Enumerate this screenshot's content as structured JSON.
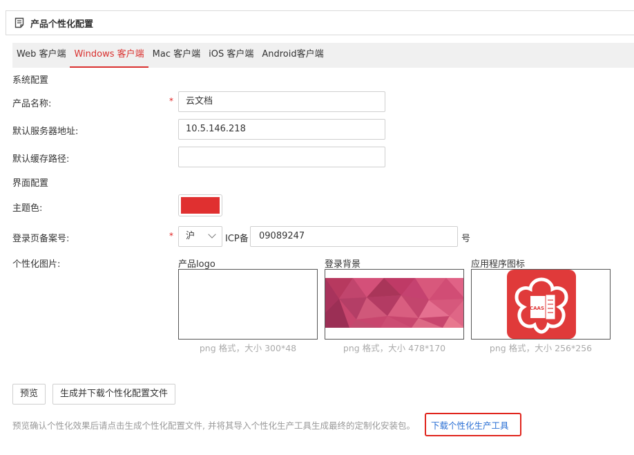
{
  "header": {
    "title": "产品个性化配置",
    "icon": "document-icon"
  },
  "tabs": [
    {
      "label": "Web 客户端",
      "active": false
    },
    {
      "label": "Windows 客户端",
      "active": true
    },
    {
      "label": "Mac 客户端",
      "active": false
    },
    {
      "label": "iOS 客户端",
      "active": false
    },
    {
      "label": "Android客户端",
      "active": false
    }
  ],
  "system": {
    "section_label": "系统配置",
    "product_name_label": "产品名称:",
    "product_name_value": "云文档",
    "server_label": "默认服务器地址:",
    "server_value": "10.5.146.218",
    "cache_label": "默认缓存路径:",
    "cache_value": ""
  },
  "ui": {
    "section_label": "界面配置",
    "theme_label": "主题色:",
    "theme_color": "#e03030",
    "icp_label": "登录页备案号:",
    "region_value": "沪",
    "icp_prefix": "ICP备",
    "icp_value": "09089247",
    "icp_suffix": "号",
    "images_label": "个性化图片:",
    "images": [
      {
        "title": "产品logo",
        "hint": "png 格式，大小 300*48"
      },
      {
        "title": "登录背景",
        "hint": "png 格式，大小 478*170"
      },
      {
        "title": "应用程序图标",
        "hint": "png 格式，大小 256*256",
        "icon_text": "CAAS"
      }
    ]
  },
  "actions": {
    "preview": "预览",
    "generate": "生成并下载个性化配置文件"
  },
  "footer": {
    "notice": "预览确认个性化效果后请点击生成个性化配置文件, 并将其导入个性化生产工具生成最终的定制化安装包。",
    "download_link": "下载个性化生产工具"
  },
  "colors": {
    "accent": "#d9302e",
    "link": "#2a6fd4",
    "highlight_border": "#e0241c"
  }
}
